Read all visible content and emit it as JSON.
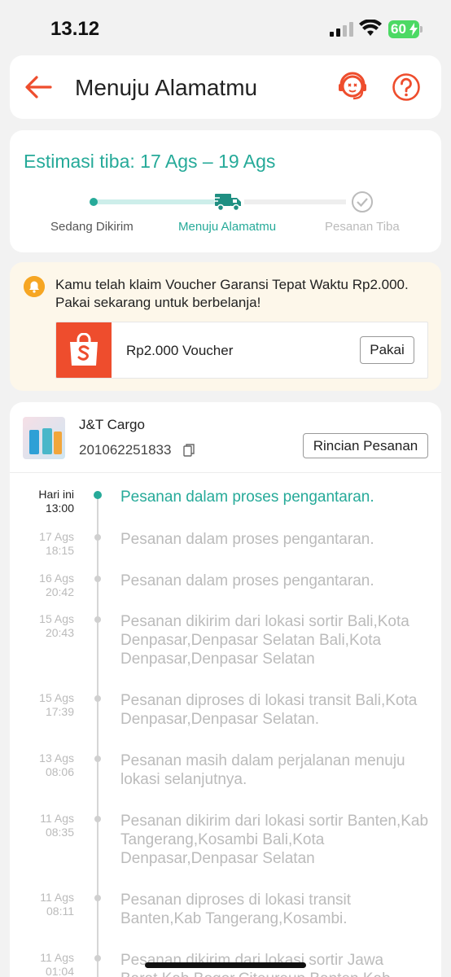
{
  "status_bar": {
    "time": "13.12",
    "battery": "60"
  },
  "header": {
    "title": "Menuju Alamatmu"
  },
  "eta": {
    "text": "Estimasi tiba: 17 Ags – 19 Ags",
    "steps": [
      "Sedang Dikirim",
      "Menuju Alamatmu",
      "Pesanan Tiba"
    ]
  },
  "voucher": {
    "message": "Kamu telah klaim Voucher Garansi Tepat Waktu Rp2.000. Pakai sekarang untuk berbelanja!",
    "name": "Rp2.000 Voucher",
    "button": "Pakai"
  },
  "shipment": {
    "courier": "J&T Cargo",
    "tracking_number": "201062251833",
    "details_button": "Rincian Pesanan"
  },
  "timeline": [
    {
      "date": "Hari ini",
      "time": "13:00",
      "text": "Pesanan dalam proses pengantaran."
    },
    {
      "date": "17 Ags",
      "time": "18:15",
      "text": "Pesanan dalam proses pengantaran."
    },
    {
      "date": "16 Ags",
      "time": "20:42",
      "text": "Pesanan dalam proses pengantaran."
    },
    {
      "date": "15 Ags",
      "time": "20:43",
      "text": "Pesanan dikirim dari lokasi sortir Bali,Kota Denpasar,Denpasar Selatan Bali,Kota Denpasar,Denpasar Selatan"
    },
    {
      "date": "15 Ags",
      "time": "17:39",
      "text": "Pesanan diproses di lokasi transit Bali,Kota Denpasar,Denpasar Selatan."
    },
    {
      "date": "13 Ags",
      "time": "08:06",
      "text": "Pesanan masih dalam perjalanan menuju lokasi selanjutnya."
    },
    {
      "date": "11 Ags",
      "time": "08:35",
      "text": "Pesanan dikirim dari lokasi sortir Banten,Kab Tangerang,Kosambi Bali,Kota Denpasar,Denpasar Selatan"
    },
    {
      "date": "11 Ags",
      "time": "08:11",
      "text": "Pesanan diproses di lokasi transit Banten,Kab Tangerang,Kosambi."
    },
    {
      "date": "11 Ags",
      "time": "01:04",
      "text": "Pesanan dikirim dari lokasi sortir Jawa Barat,Kab Bogor,Citeureup Banten,Kab"
    }
  ]
}
